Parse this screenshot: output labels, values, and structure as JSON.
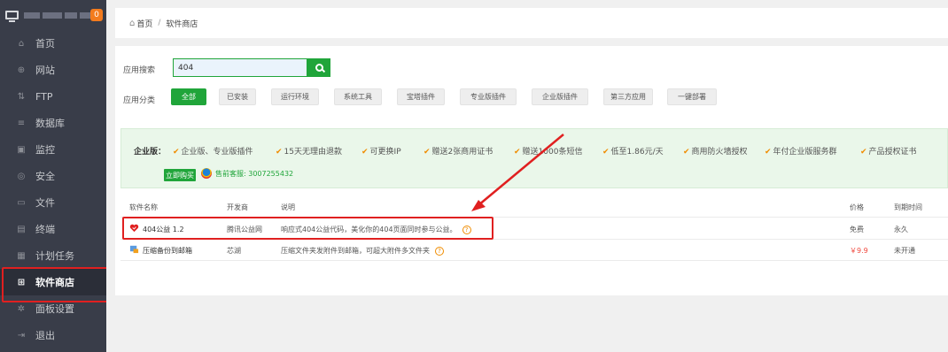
{
  "sidebar": {
    "badge": "0",
    "items": [
      {
        "label": "首页",
        "icon": "home-icon",
        "glyph": "⌂"
      },
      {
        "label": "网站",
        "icon": "globe-icon",
        "glyph": "⊕"
      },
      {
        "label": "FTP",
        "icon": "ftp-icon",
        "glyph": "⇅"
      },
      {
        "label": "数据库",
        "icon": "database-icon",
        "glyph": "≡"
      },
      {
        "label": "监控",
        "icon": "monitor-icon",
        "glyph": "▣"
      },
      {
        "label": "安全",
        "icon": "shield-icon",
        "glyph": "◎"
      },
      {
        "label": "文件",
        "icon": "folder-icon",
        "glyph": "▭"
      },
      {
        "label": "终端",
        "icon": "terminal-icon",
        "glyph": "▤"
      },
      {
        "label": "计划任务",
        "icon": "calendar-icon",
        "glyph": "▦"
      },
      {
        "label": "软件商店",
        "icon": "grid-icon",
        "glyph": "⊞"
      },
      {
        "label": "面板设置",
        "icon": "gear-icon",
        "glyph": "✲"
      },
      {
        "label": "退出",
        "icon": "logout-icon",
        "glyph": "⇥"
      }
    ]
  },
  "breadcrumb": {
    "home": "首页",
    "sep": "/",
    "current": "软件商店"
  },
  "search": {
    "label": "应用搜索",
    "value": "404"
  },
  "categories": {
    "label": "应用分类",
    "items": [
      "全部",
      "已安装",
      "运行环境",
      "系统工具",
      "宝塔插件",
      "专业版插件",
      "企业版插件",
      "第三方应用",
      "一键部署"
    ]
  },
  "enterprise": {
    "title": "企业版：",
    "features": [
      "企业版、专业版插件",
      "15天无理由退款",
      "可更换IP",
      "赠送2张商用证书",
      "赠送1000条短信",
      "低至1.86元/天",
      "商用防火墙授权",
      "年付企业版服务群",
      "产品授权证书"
    ],
    "buy_label": "立即购买",
    "qq_label": "售前客服: 3007255432"
  },
  "table": {
    "headers": {
      "name": "软件名称",
      "dev": "开发商",
      "desc": "说明",
      "price": "价格",
      "expire": "到期时间"
    },
    "rows": [
      {
        "name": "404公益 1.2",
        "dev": "腾讯公益网",
        "desc": "响应式404公益代码，美化你的404页面同时参与公益。",
        "price": "免费",
        "expire": "永久",
        "icon": "heart-icon",
        "price_color": "#555555"
      },
      {
        "name": "压缩备份到邮箱",
        "dev": "芯湖",
        "desc": "压缩文件夹发附件到邮箱，可超大附件多文件夹",
        "price": "￥9.9",
        "expire": "未开通",
        "icon": "mail-backup-icon",
        "price_color": "#f0483e"
      }
    ]
  },
  "colors": {
    "accent": "#20a53a",
    "highlight": "#e02020",
    "sidebar": "#393d49"
  }
}
